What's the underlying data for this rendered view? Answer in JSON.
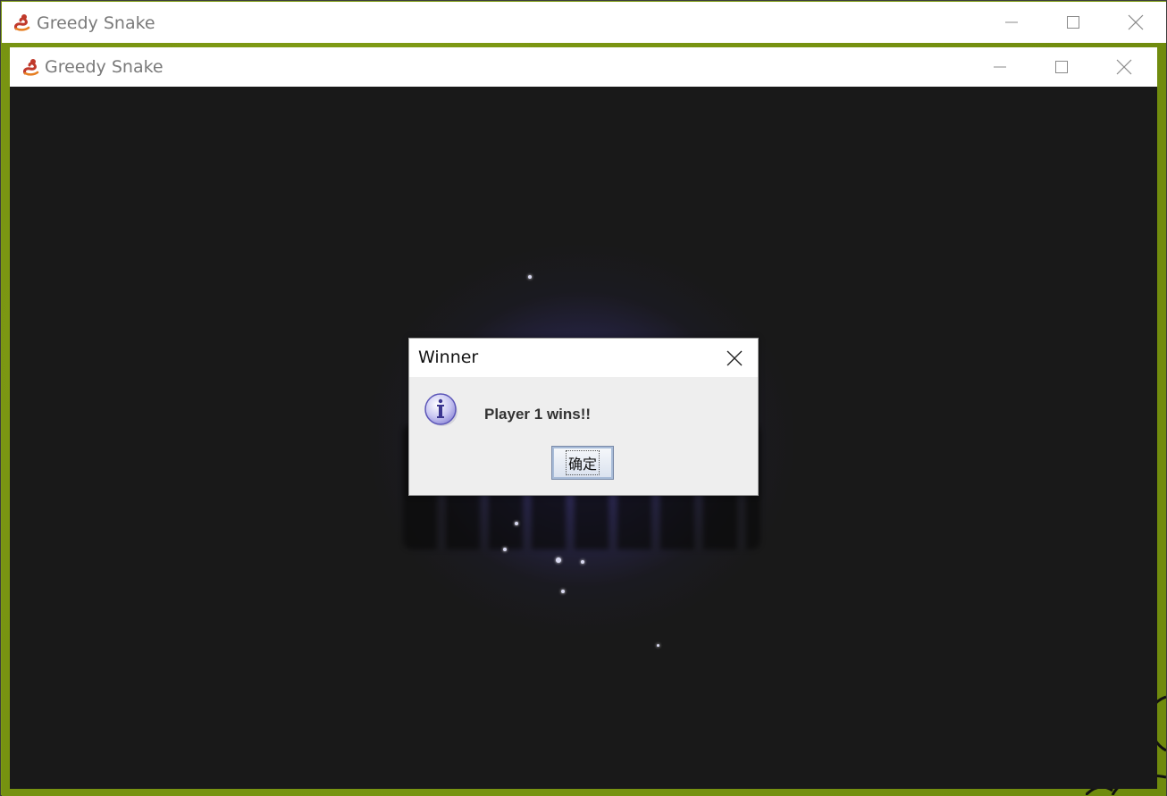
{
  "outer_window": {
    "title": "Greedy Snake",
    "icon": "snake-icon",
    "controls": [
      "minimize-icon",
      "maximize-icon",
      "close-icon"
    ]
  },
  "inner_window": {
    "title": "Greedy Snake",
    "icon": "snake-icon",
    "controls": [
      "minimize-icon",
      "maximize-icon",
      "close-icon"
    ]
  },
  "dialog": {
    "title": "Winner",
    "icon": "info-icon",
    "message": "Player 1 wins!!",
    "ok_label": "确定"
  },
  "colors": {
    "board_green": "#7d9a12",
    "game_background": "#191919",
    "glow": "#463c96"
  }
}
